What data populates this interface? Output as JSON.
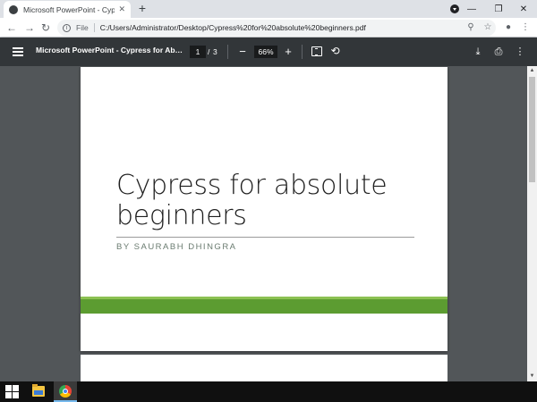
{
  "browser": {
    "tab": {
      "title": "Microsoft PowerPoint - Cypress f",
      "close_glyph": "✕"
    },
    "new_tab_glyph": "+",
    "window_controls": {
      "minimize": "—",
      "restore": "❐",
      "close": "✕"
    },
    "nav": {
      "back": "←",
      "forward": "→",
      "reload": "↻"
    },
    "address": {
      "scheme_label": "File",
      "url": "C:/Users/Administrator/Desktop/Cypress%20for%20absolute%20beginners.pdf"
    },
    "icons": {
      "zoom": "⚲",
      "star": "☆",
      "profile": "●",
      "menu": "⋮"
    }
  },
  "pdf_toolbar": {
    "title": "Microsoft PowerPoint - Cypress for Absolute Beginners",
    "current_page": "1",
    "page_separator": "/",
    "total_pages": "3",
    "zoom_out_glyph": "−",
    "zoom_level": "66%",
    "zoom_in_glyph": "+",
    "rotate_glyph": "⟲",
    "download_glyph": "⤓",
    "print_glyph": "⎙",
    "more_glyph": "⋮"
  },
  "slide": {
    "title": "Cypress for absolute beginners",
    "subtitle": "BY SAURABH DHINGRA",
    "colors": {
      "accent_light": "#8cc152",
      "accent_dark": "#5c9c31",
      "subtitle": "#6a7b70"
    }
  },
  "scrollbar": {
    "up": "▲",
    "down": "▼"
  },
  "colors": {
    "viewer_bg": "#525659",
    "toolbar_bg": "#323639",
    "taskbar_bg": "#101010"
  }
}
